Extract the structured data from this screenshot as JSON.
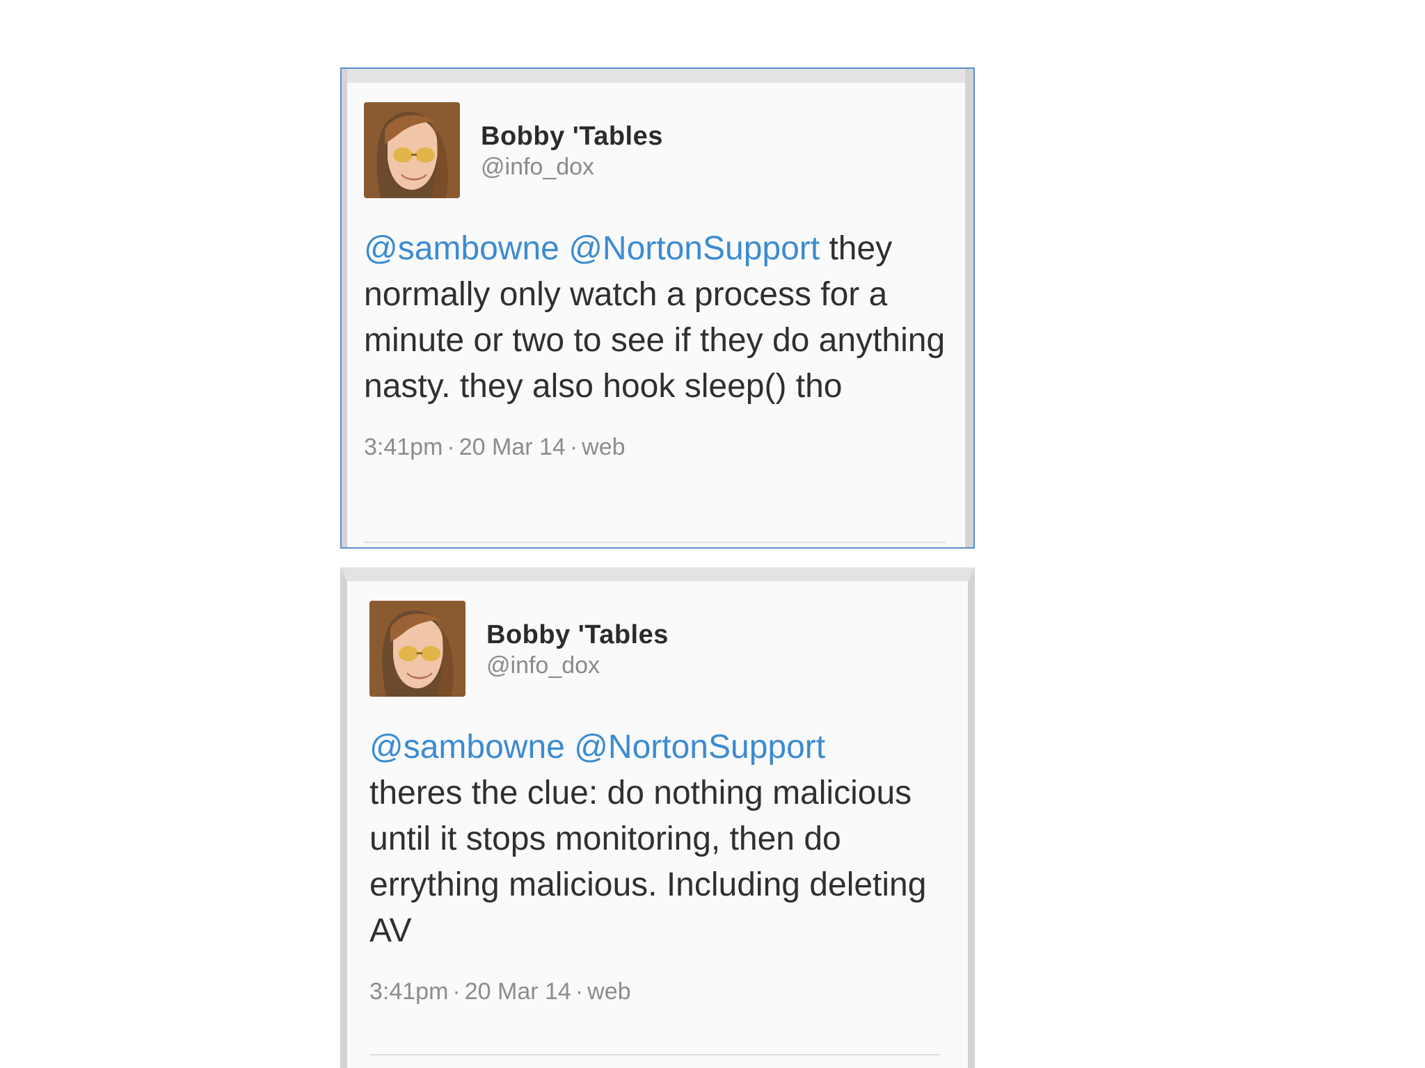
{
  "tweets": [
    {
      "author": {
        "name": "Bobby 'Tables",
        "handle": "@info_dox"
      },
      "mentions": [
        "@sambowne",
        "@NortonSupport"
      ],
      "body": "they normally only watch a process for a minute or two to see if they do anything nasty. they also hook sleep() tho",
      "meta": {
        "time": "3:41pm",
        "date": "20 Mar 14",
        "source": "web",
        "separator": "·"
      }
    },
    {
      "author": {
        "name": "Bobby 'Tables",
        "handle": "@info_dox"
      },
      "mentions": [
        "@sambowne",
        "@NortonSupport"
      ],
      "body": "theres the clue: do nothing malicious until it stops monitoring, then do errything malicious. Including deleting AV",
      "meta": {
        "time": "3:41pm",
        "date": "20 Mar 14",
        "source": "web",
        "separator": "·"
      }
    }
  ],
  "colors": {
    "mention": "#3b8bd1",
    "name": "#2b2b2b",
    "muted": "#8a8a8a",
    "selected_border": "#5b8fc9"
  },
  "icons": {
    "avatar": "user-photo-avatar"
  }
}
